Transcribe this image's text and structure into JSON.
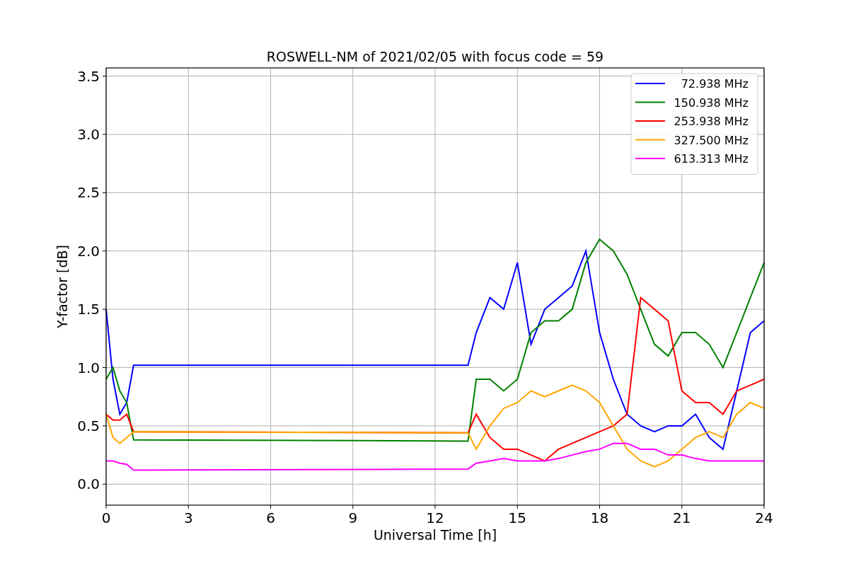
{
  "chart_data": {
    "type": "line",
    "title": "ROSWELL-NM of 2021/02/05 with focus code = 59",
    "xlabel": "Universal Time [h]",
    "ylabel": "Y-factor [dB]",
    "x": [
      0,
      0.25,
      0.5,
      0.75,
      1,
      13.2,
      13.5,
      14,
      14.5,
      15,
      15.5,
      16,
      16.5,
      17,
      17.5,
      18,
      18.5,
      19,
      19.5,
      20,
      20.5,
      21,
      21.5,
      22,
      22.5,
      23,
      23.5,
      24
    ],
    "series": [
      {
        "name": "72.938 MHz",
        "color": "#0000ff",
        "values": [
          1.5,
          0.9,
          0.6,
          0.7,
          1.02,
          1.02,
          1.3,
          1.6,
          1.5,
          1.9,
          1.2,
          1.5,
          1.6,
          1.7,
          2.0,
          1.3,
          0.9,
          0.6,
          0.5,
          0.45,
          0.5,
          0.5,
          0.6,
          0.4,
          0.3,
          0.8,
          1.3,
          1.4
        ]
      },
      {
        "name": "150.938 MHz",
        "color": "#008000",
        "values": [
          0.9,
          1.0,
          0.8,
          0.7,
          0.38,
          0.37,
          0.9,
          0.9,
          0.8,
          0.9,
          1.3,
          1.4,
          1.4,
          1.5,
          1.9,
          2.1,
          2.0,
          1.8,
          1.5,
          1.2,
          1.1,
          1.3,
          1.3,
          1.2,
          1.0,
          1.3,
          1.6,
          1.9
        ]
      },
      {
        "name": "253.938 MHz",
        "color": "#ff0000",
        "values": [
          0.6,
          0.55,
          0.55,
          0.6,
          0.45,
          0.44,
          0.6,
          0.4,
          0.3,
          0.3,
          0.25,
          0.2,
          0.3,
          0.35,
          0.4,
          0.45,
          0.5,
          0.6,
          1.6,
          1.5,
          1.4,
          0.8,
          0.7,
          0.7,
          0.6,
          0.8,
          0.85,
          0.9
        ]
      },
      {
        "name": "327.500 MHz",
        "color": "#ffa500",
        "values": [
          0.6,
          0.4,
          0.35,
          0.4,
          0.45,
          0.44,
          0.3,
          0.5,
          0.65,
          0.7,
          0.8,
          0.75,
          0.8,
          0.85,
          0.8,
          0.7,
          0.5,
          0.3,
          0.2,
          0.15,
          0.2,
          0.3,
          0.4,
          0.45,
          0.4,
          0.6,
          0.7,
          0.65
        ]
      },
      {
        "name": "613.313 MHz",
        "color": "#ff00ff",
        "values": [
          0.2,
          0.2,
          0.18,
          0.17,
          0.12,
          0.13,
          0.18,
          0.2,
          0.22,
          0.2,
          0.2,
          0.2,
          0.22,
          0.25,
          0.28,
          0.3,
          0.35,
          0.35,
          0.3,
          0.3,
          0.25,
          0.25,
          0.22,
          0.2,
          0.2,
          0.2,
          0.2,
          0.2
        ]
      }
    ],
    "grid": true,
    "legend": true,
    "xlim": [
      0,
      24
    ],
    "ylim": [
      -0.18,
      3.57
    ],
    "xticks": [
      0,
      3,
      6,
      9,
      12,
      15,
      18,
      21,
      24
    ],
    "yticks": [
      {
        "value": 0,
        "label": "0.0"
      },
      {
        "value": 0.5,
        "label": "0.5"
      },
      {
        "value": 1,
        "label": "1.0"
      },
      {
        "value": 1.5,
        "label": "1.5"
      },
      {
        "value": 2,
        "label": "2.0"
      },
      {
        "value": 2.5,
        "label": "2.5"
      },
      {
        "value": 3,
        "label": "3.0"
      },
      {
        "value": 3.5,
        "label": "3.5"
      }
    ]
  }
}
